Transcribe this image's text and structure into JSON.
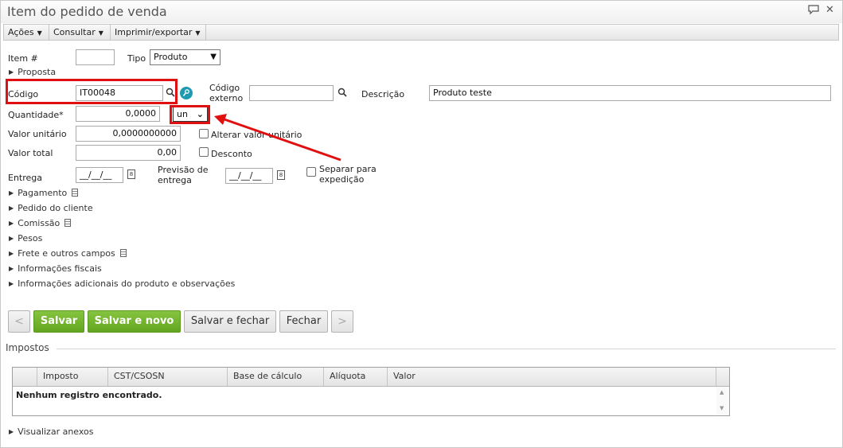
{
  "window": {
    "title": "Item do pedido de venda",
    "chat_icon": "speech-bubble-icon",
    "close_icon": "close-icon"
  },
  "menu": [
    {
      "label": "Ações"
    },
    {
      "label": "Consultar"
    },
    {
      "label": "Imprimir/exportar"
    }
  ],
  "form": {
    "item_label": "Item #",
    "item_value": "",
    "tipo_label": "Tipo",
    "tipo_value": "Produto",
    "proposta_label": "Proposta",
    "codigo_label": "Código",
    "codigo_value": "IT00048",
    "codigo_externo_label_1": "Código",
    "codigo_externo_label_2": "externo",
    "codigo_externo_value": "",
    "descricao_label": "Descrição",
    "descricao_value": "Produto teste",
    "quantidade_label": "Quantidade*",
    "quantidade_value": "0,0000",
    "unidade_value": "un",
    "valor_unitario_label": "Valor unitário",
    "valor_unitario_value": "0,0000000000",
    "alterar_valor_label": "Alterar valor unitário",
    "valor_total_label": "Valor total",
    "valor_total_value": "0,00",
    "desconto_label": "Desconto",
    "entrega_label": "Entrega",
    "entrega_value": "__/__/__",
    "previsao_label_1": "Previsão de",
    "previsao_label_2": "entrega",
    "previsao_value": "__/__/__",
    "separar_label_1": "Separar para",
    "separar_label_2": "expedição"
  },
  "sections": [
    {
      "label": "Pagamento",
      "has_doc_icon": true
    },
    {
      "label": "Pedido do cliente",
      "has_doc_icon": false
    },
    {
      "label": "Comissão",
      "has_doc_icon": true
    },
    {
      "label": "Pesos",
      "has_doc_icon": false
    },
    {
      "label": "Frete e outros campos",
      "has_doc_icon": true
    },
    {
      "label": "Informações fiscais",
      "has_doc_icon": false
    },
    {
      "label": "Informações adicionais do produto e observações",
      "has_doc_icon": false
    }
  ],
  "buttons": {
    "prev": "<",
    "salvar": "Salvar",
    "salvar_novo": "Salvar e novo",
    "salvar_fechar": "Salvar e fechar",
    "fechar": "Fechar",
    "next": ">"
  },
  "impostos": {
    "title": "Impostos",
    "columns": [
      "",
      "Imposto",
      "CST/CSOSN",
      "Base de cálculo",
      "Alíquota",
      "Valor"
    ],
    "empty_message": "Nenhum registro encontrado."
  },
  "footer": {
    "anexos_label": "Visualizar anexos"
  },
  "colors": {
    "highlight": "#e01010",
    "primary_button": "#64a51f",
    "info_icon": "#1e9bb0"
  }
}
